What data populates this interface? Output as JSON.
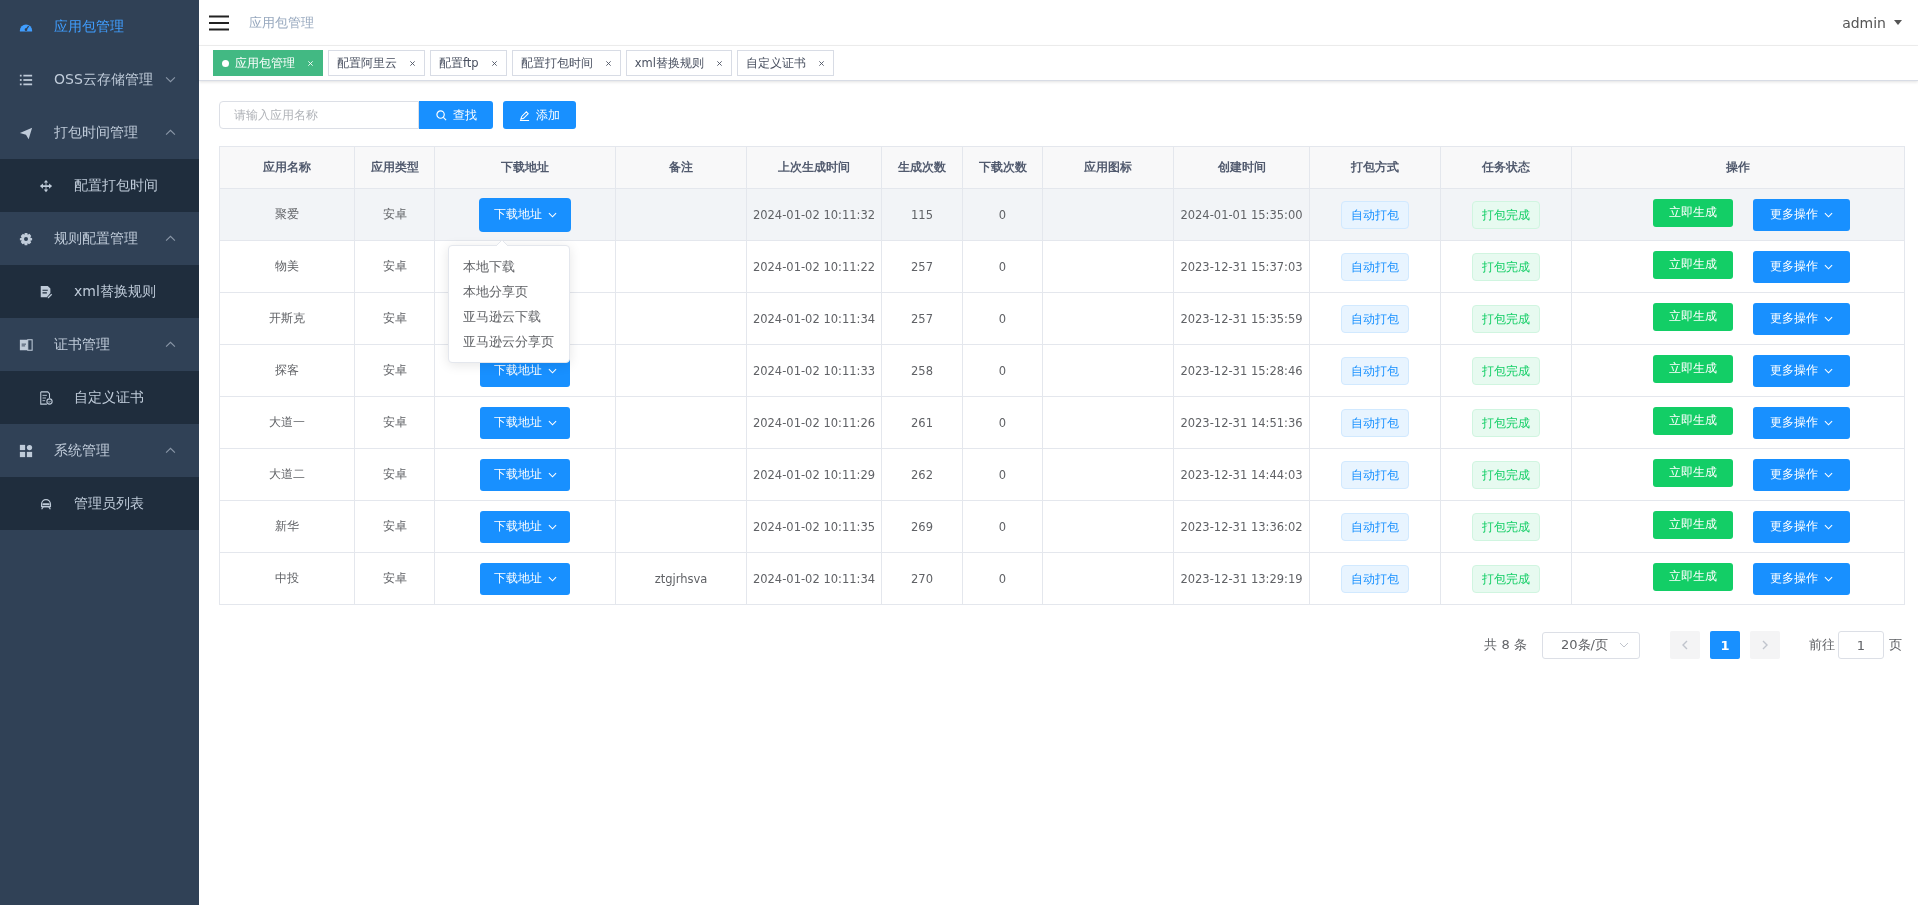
{
  "sidebar": {
    "items": [
      {
        "label": "应用包管理",
        "selected": true
      },
      {
        "label": "OSS云存储管理",
        "selected": false,
        "expanded": false
      },
      {
        "label": "打包时间管理",
        "selected": false,
        "expanded": true,
        "children": [
          {
            "label": "配置打包时间",
            "selected": false
          }
        ]
      },
      {
        "label": "规则配置管理",
        "selected": false,
        "expanded": true,
        "children": [
          {
            "label": "xml替换规则",
            "selected": false
          }
        ]
      },
      {
        "label": "证书管理",
        "selected": false,
        "expanded": true,
        "children": [
          {
            "label": "自定义证书",
            "selected": false
          }
        ]
      },
      {
        "label": "系统管理",
        "selected": false,
        "expanded": true,
        "children": [
          {
            "label": "管理员列表",
            "selected": false
          }
        ]
      }
    ]
  },
  "header": {
    "breadcrumb": "应用包管理",
    "user": "admin"
  },
  "tabs": [
    {
      "label": "应用包管理",
      "selected": true
    },
    {
      "label": "配置阿里云",
      "selected": false
    },
    {
      "label": "配置ftp",
      "selected": false
    },
    {
      "label": "配置打包时间",
      "selected": false
    },
    {
      "label": "xml替换规则",
      "selected": false
    },
    {
      "label": "自定义证书",
      "selected": false
    }
  ],
  "search": {
    "placeholder": "请输入应用名称",
    "search_button": "查找",
    "add_button": "添加"
  },
  "table": {
    "columns": [
      "应用名称",
      "应用类型",
      "下载地址",
      "备注",
      "上次生成时间",
      "生成次数",
      "下载次数",
      "应用图标",
      "创建时间",
      "打包方式",
      "任务状态",
      "操作"
    ],
    "rows": [
      {
        "name": "聚爱",
        "type": "安卓",
        "download": "下载地址",
        "download_open": true,
        "hovered": true,
        "note": "",
        "last_time": "2024-01-02 10:11:32",
        "gen_count": "115",
        "dl_count": "0",
        "created": "2024-01-01 15:35:00",
        "pack_mode": "自动打包",
        "status": "打包完成",
        "generate": "立即生成",
        "more": "更多操作"
      },
      {
        "name": "物美",
        "type": "安卓",
        "download_open": false,
        "hovered": false,
        "note": "",
        "last_time": "2024-01-02 10:11:22",
        "gen_count": "257",
        "dl_count": "0",
        "created": "2023-12-31 15:37:03",
        "pack_mode": "自动打包",
        "status": "打包完成",
        "generate": "立即生成",
        "more": "更多操作"
      },
      {
        "name": "开斯克",
        "type": "安卓",
        "download_open": false,
        "hovered": false,
        "note": "",
        "last_time": "2024-01-02 10:11:34",
        "gen_count": "257",
        "dl_count": "0",
        "created": "2023-12-31 15:35:59",
        "pack_mode": "自动打包",
        "status": "打包完成",
        "generate": "立即生成",
        "more": "更多操作"
      },
      {
        "name": "探客",
        "type": "安卓",
        "download": "下载地址",
        "download_open": false,
        "hovered": false,
        "note": "",
        "last_time": "2024-01-02 10:11:33",
        "gen_count": "258",
        "dl_count": "0",
        "created": "2023-12-31 15:28:46",
        "pack_mode": "自动打包",
        "status": "打包完成",
        "generate": "立即生成",
        "more": "更多操作"
      },
      {
        "name": "大道一",
        "type": "安卓",
        "download": "下载地址",
        "download_open": false,
        "hovered": false,
        "note": "",
        "last_time": "2024-01-02 10:11:26",
        "gen_count": "261",
        "dl_count": "0",
        "created": "2023-12-31 14:51:36",
        "pack_mode": "自动打包",
        "status": "打包完成",
        "generate": "立即生成",
        "more": "更多操作"
      },
      {
        "name": "大道二",
        "type": "安卓",
        "download": "下载地址",
        "download_open": false,
        "hovered": false,
        "note": "",
        "last_time": "2024-01-02 10:11:29",
        "gen_count": "262",
        "dl_count": "0",
        "created": "2023-12-31 14:44:03",
        "pack_mode": "自动打包",
        "status": "打包完成",
        "generate": "立即生成",
        "more": "更多操作"
      },
      {
        "name": "新华",
        "type": "安卓",
        "download": "下载地址",
        "download_open": false,
        "hovered": false,
        "note": "",
        "last_time": "2024-01-02 10:11:35",
        "gen_count": "269",
        "dl_count": "0",
        "created": "2023-12-31 13:36:02",
        "pack_mode": "自动打包",
        "status": "打包完成",
        "generate": "立即生成",
        "more": "更多操作"
      },
      {
        "name": "中投",
        "type": "安卓",
        "download": "下载地址",
        "download_open": false,
        "hovered": false,
        "note": "ztgjrhsva",
        "last_time": "2024-01-02 10:11:34",
        "gen_count": "270",
        "dl_count": "0",
        "created": "2023-12-31 13:29:19",
        "pack_mode": "自动打包",
        "status": "打包完成",
        "generate": "立即生成",
        "more": "更多操作"
      }
    ]
  },
  "download_menu": {
    "items": [
      "本地下载",
      "本地分享页",
      "亚马逊云下载",
      "亚马逊云分享页"
    ]
  },
  "pagination": {
    "total": "共 8 条",
    "page_size": "20条/页",
    "pages": [
      {
        "label": "1",
        "selected": true
      }
    ],
    "goto_label": "前往",
    "goto_value": "1",
    "goto_suffix": "页"
  }
}
